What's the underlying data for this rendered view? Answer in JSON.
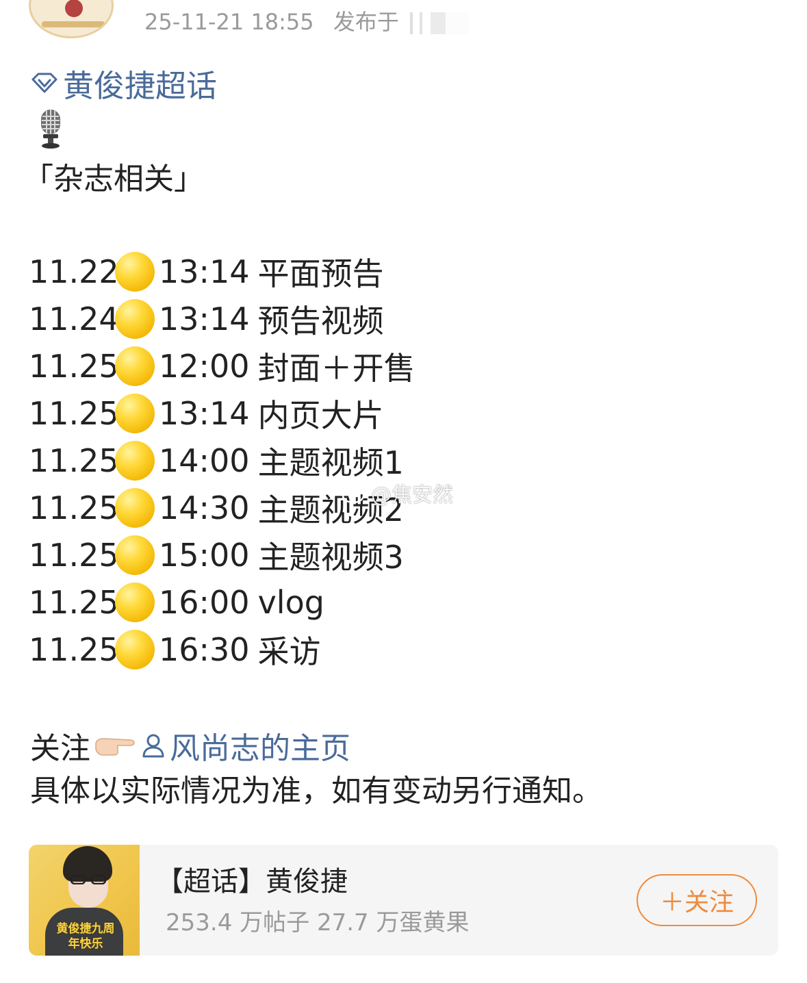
{
  "header": {
    "timestamp": "25-11-21 18:55",
    "published_prefix": "发布于"
  },
  "post": {
    "topic": "黄俊捷超话",
    "section_title": "「杂志相关」",
    "schedule": [
      {
        "date": "11.22",
        "time": "13:14",
        "event": "平面预告"
      },
      {
        "date": "11.24",
        "time": "13:14",
        "event": "预告视频"
      },
      {
        "date": "11.25",
        "time": "12:00",
        "event": "封面＋开售"
      },
      {
        "date": "11.25",
        "time": "13:14",
        "event": "内页大片"
      },
      {
        "date": "11.25",
        "time": "14:00",
        "event": "主题视频1"
      },
      {
        "date": "11.25",
        "time": "14:30",
        "event": "主题视频2"
      },
      {
        "date": "11.25",
        "time": "15:00",
        "event": "主题视频3"
      },
      {
        "date": "11.25",
        "time": "16:00",
        "event": "vlog"
      },
      {
        "date": "11.25",
        "time": "16:30",
        "event": "采访"
      }
    ],
    "follow_prefix": "关注",
    "follow_link": "风尚志的主页",
    "note": "具体以实际情况为准，如有变动另行通知。"
  },
  "watermark": "@焦安然",
  "card": {
    "name": "【超话】黄俊捷",
    "stats": "253.4 万帖子 27.7 万蛋黄果",
    "thumb_text": "黄俊捷九周年快乐",
    "button_label": "＋关注"
  },
  "colors": {
    "link": "#4a6b9a",
    "accent": "#f08a3a",
    "muted": "#9a9a9a"
  },
  "icons": {
    "topic": "diamond-icon",
    "microphone": "microphone-emoji",
    "schedule_bullet": "yellow-circle-emoji",
    "pointer": "pointing-hand-emoji",
    "profile": "user-icon"
  }
}
